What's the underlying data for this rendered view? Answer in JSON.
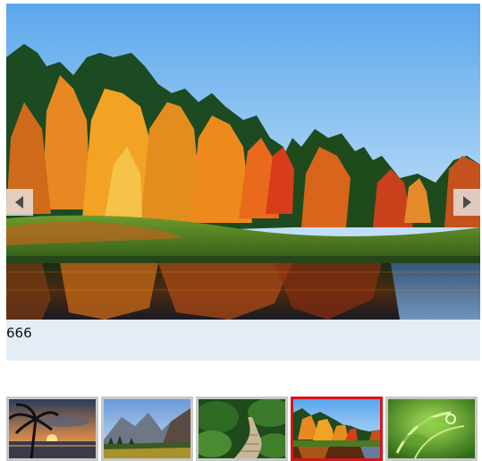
{
  "main_image": {
    "icon": "autumn-forest-lake-photo",
    "caption": "666"
  },
  "nav": {
    "prev_icon": "triangle-left-icon",
    "next_icon": "triangle-right-icon"
  },
  "thumbnails": [
    {
      "icon": "palm-tree-sunset-photo",
      "active": false
    },
    {
      "icon": "mountain-valley-photo",
      "active": false
    },
    {
      "icon": "forest-boardwalk-photo",
      "active": false
    },
    {
      "icon": "autumn-forest-lake-photo",
      "active": true
    },
    {
      "icon": "green-fern-closeup-photo",
      "active": false
    }
  ],
  "colors": {
    "caption_bg": "#e4edf5",
    "active_border": "#d9141a",
    "thumb_border": "#c8c8c8"
  }
}
